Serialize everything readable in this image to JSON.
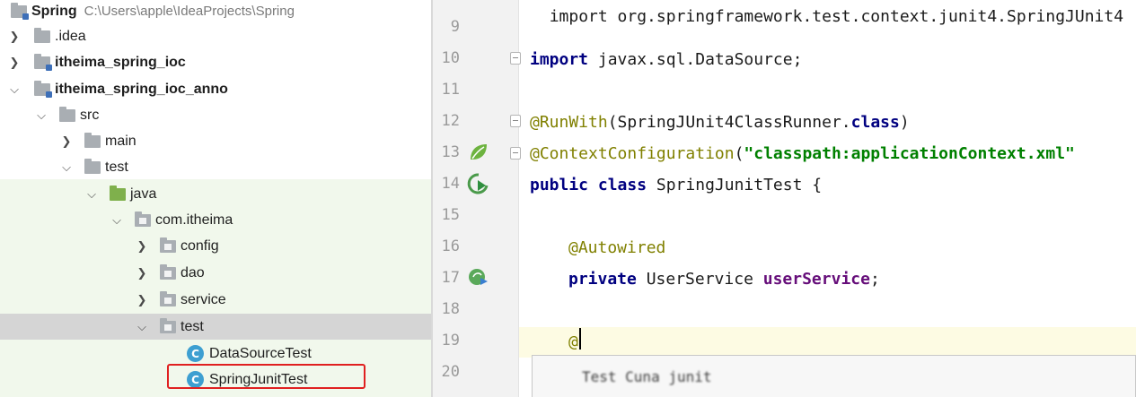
{
  "project_tree": {
    "root": {
      "name": "Spring",
      "path": "C:\\Users\\apple\\IdeaProjects\\Spring"
    },
    "items": [
      {
        "label": ".idea"
      },
      {
        "label": "itheima_spring_ioc"
      },
      {
        "label": "itheima_spring_ioc_anno"
      },
      {
        "label": "src"
      },
      {
        "label": "main"
      },
      {
        "label": "test"
      },
      {
        "label": "java"
      },
      {
        "label": "com.itheima"
      },
      {
        "label": "config"
      },
      {
        "label": "dao"
      },
      {
        "label": "service"
      },
      {
        "label": "test"
      },
      {
        "label": "DataSourceTest"
      },
      {
        "label": "SpringJunitTest"
      }
    ],
    "class_icon_letter": "C"
  },
  "editor": {
    "top_partial": "import org.springframework.test.context.junit4.SpringJUnit4",
    "line_numbers": [
      "9",
      "10",
      "11",
      "12",
      "13",
      "14",
      "15",
      "16",
      "17",
      "18",
      "19",
      "20"
    ],
    "lines": {
      "l10_kw": "import",
      "l10_rest": " javax.sql.DataSource;",
      "l12_ann": "@RunWith",
      "l12_mid": "(SpringJUnit4ClassRunner.",
      "l12_kw": "class",
      "l12_end": ")",
      "l13_ann": "@ContextConfiguration",
      "l13_paren": "(",
      "l13_str": "\"classpath:applicationContext.xml\"",
      "l14_kw": "public class",
      "l14_rest": " SpringJunitTest {",
      "l16_ann": "@Autowired",
      "l17_kw": "private",
      "l17_type": " UserService ",
      "l17_fld": "userService",
      "l17_end": ";",
      "l19_text": "@"
    },
    "completion_popup": {
      "item": "Test Cuna junit"
    }
  },
  "colors": {
    "keyword": "#000080",
    "annotation": "#808000",
    "string": "#008000",
    "field": "#660e7a",
    "highlight_border": "#e02020",
    "test_source_background": "#f1f8ec"
  }
}
